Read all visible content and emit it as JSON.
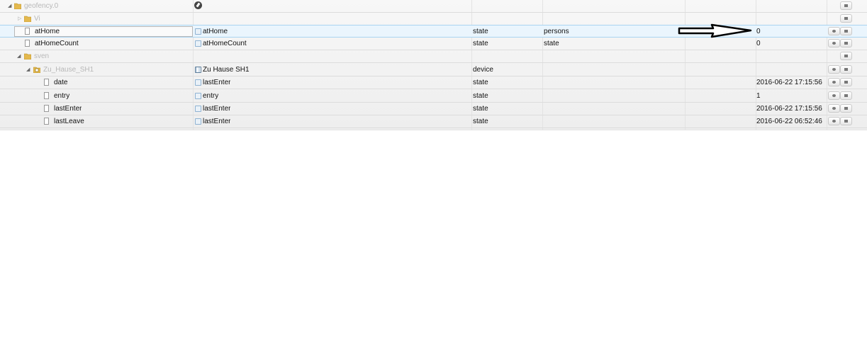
{
  "tree": {
    "root": {
      "label": "geofency.0"
    },
    "vi": {
      "label": "Vi"
    },
    "rows": [
      {
        "name": "atHome",
        "display_name": "atHome",
        "type": "state",
        "role": "persons",
        "value": "0"
      },
      {
        "name": "atHomeCount",
        "display_name": "atHomeCount",
        "type": "state",
        "role": "state",
        "value": "0"
      }
    ],
    "sven": {
      "label": "sven"
    },
    "zu_hause": {
      "label": "Zu_Hause_SH1",
      "display_name": "Zu Hause SH1",
      "type": "device"
    },
    "children": [
      {
        "name": "date",
        "display_name": "lastEnter",
        "type": "state",
        "value": "2016-06-22 17:15:56"
      },
      {
        "name": "entry",
        "display_name": "entry",
        "type": "state",
        "value": "1"
      },
      {
        "name": "lastEnter",
        "display_name": "lastEnter",
        "type": "state",
        "value": "2016-06-22 17:15:56"
      },
      {
        "name": "lastLeave",
        "display_name": "lastEnter",
        "type": "state",
        "value": "2016-06-22 06:52:46"
      }
    ]
  },
  "icons": {
    "folder": "folder-icon",
    "file": "file-icon",
    "edit": "gear-icon",
    "delete": "trash-icon",
    "annotation": "arrow-annotation"
  },
  "colors": {
    "selection_bg": "#eaf5fd",
    "selection_border": "#a9d4f1",
    "folder_label": "#b8b8b8",
    "folder_icon": "#e4b94f"
  }
}
